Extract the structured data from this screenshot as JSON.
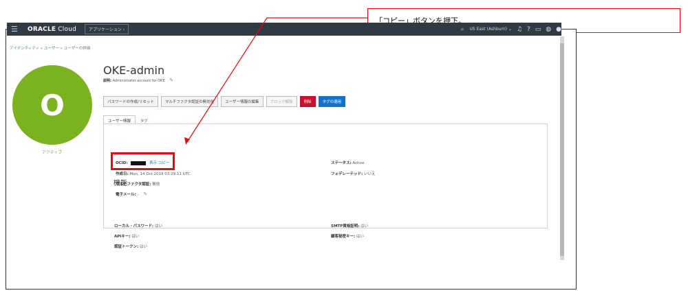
{
  "callout": {
    "text": "「コピー」ボタンを押下。"
  },
  "topbar": {
    "brand_oracle": "ORACLE",
    "brand_cloud": "Cloud",
    "apps_button": "アプリケーション",
    "region": "US East (Ashburn)"
  },
  "breadcrumb": {
    "part1": "アイデンティティ",
    "part2": "ユーザー",
    "current": "ユーザーの詳細"
  },
  "user": {
    "initial": "O",
    "status": "アクティブ",
    "name": "OKE-admin",
    "description_label": "説明:",
    "description_value": "Administrator account for OKE"
  },
  "actions": [
    "パスワードの作成/リセット",
    "マルチファクタ認証の無効化",
    "ユーザー情報の編集",
    "ブロック解除",
    "削除",
    "タグの適用"
  ],
  "tabs": {
    "info": "ユーザー情報",
    "tags": "タグ"
  },
  "info": {
    "ocid_label": "OCID:",
    "ocid_show": "表示",
    "ocid_copy": "コピー",
    "created_label": "作成日:",
    "created_value": "Mon, 14 Oct 2019 03:29:11 UTC",
    "mfa_label": "マルチファクタ認証:",
    "mfa_value": "無効",
    "email_label": "電子メール:",
    "email_value": "-",
    "status_label": "ステータス:",
    "status_value": "Active",
    "federated_label": "フェデレーテッド:",
    "federated_value": "いいえ"
  },
  "capabilities": {
    "heading": "機能",
    "local_password_label": "ローカル・パスワード:",
    "local_password_value": "はい",
    "api_keys_label": "APIキー:",
    "api_keys_value": "はい",
    "auth_tokens_label": "認証トークン:",
    "auth_tokens_value": "はい",
    "smtp_label": "SMTP資格証明:",
    "smtp_value": "はい",
    "secret_keys_label": "顧客秘密キー:",
    "secret_keys_value": "はい"
  }
}
